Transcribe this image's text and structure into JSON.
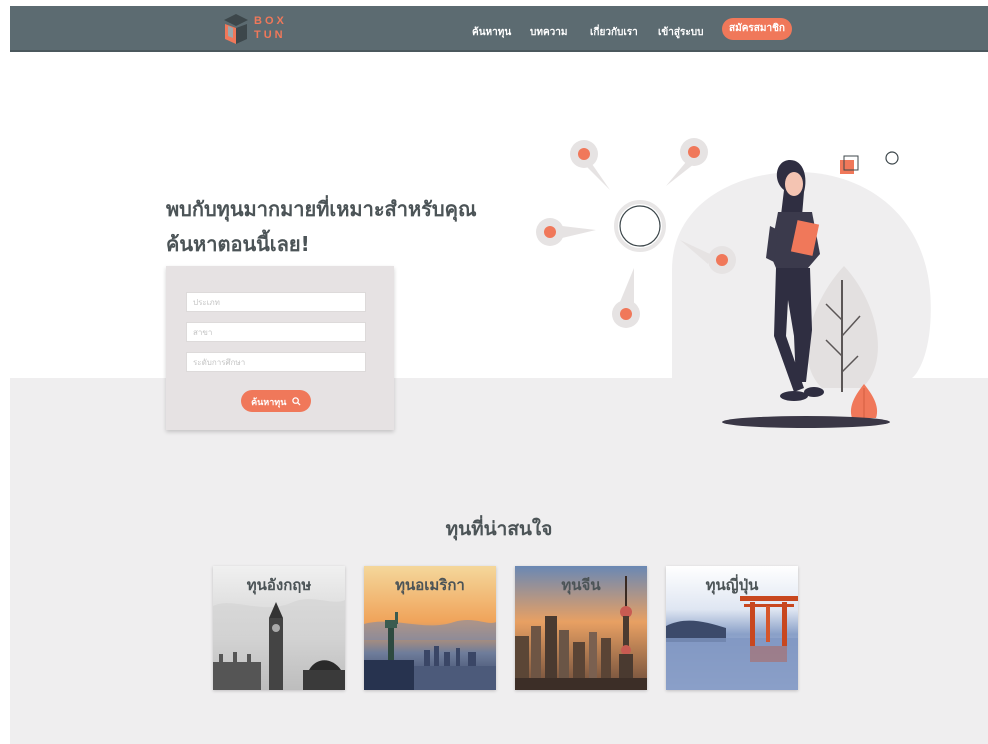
{
  "nav": {
    "logo": {
      "line1": "BOX",
      "line2": "TUN"
    },
    "links": [
      {
        "label": "ค้นหาทุน"
      },
      {
        "label": "บทความ"
      },
      {
        "label": "เกี่ยวกับเรา"
      },
      {
        "label": "เข้าสู่ระบบ"
      }
    ],
    "signup_label": "สมัครสมาชิก"
  },
  "hero": {
    "title_line1": "พบกับทุนมากมายที่เหมาะสำหรับคุณ",
    "title_line2": "ค้นหาตอนนี้เลย!"
  },
  "search": {
    "fields": [
      {
        "placeholder": "ประเภท"
      },
      {
        "placeholder": "สาขา"
      },
      {
        "placeholder": "ระดับการศึกษา"
      }
    ],
    "button_label": "ค้นหาทุน",
    "button_icon": "search-icon"
  },
  "section": {
    "title": "ทุนที่น่าสนใจ",
    "cards": [
      {
        "label": "ทุนอังกฤษ"
      },
      {
        "label": "ทุนอเมริกา"
      },
      {
        "label": "ทุนจีน"
      },
      {
        "label": "ทุนญี่ปุ่น"
      }
    ]
  },
  "colors": {
    "accent": "#f0785a",
    "nav": "#5c6b71",
    "text": "#4c5457",
    "band": "#efeeef"
  }
}
